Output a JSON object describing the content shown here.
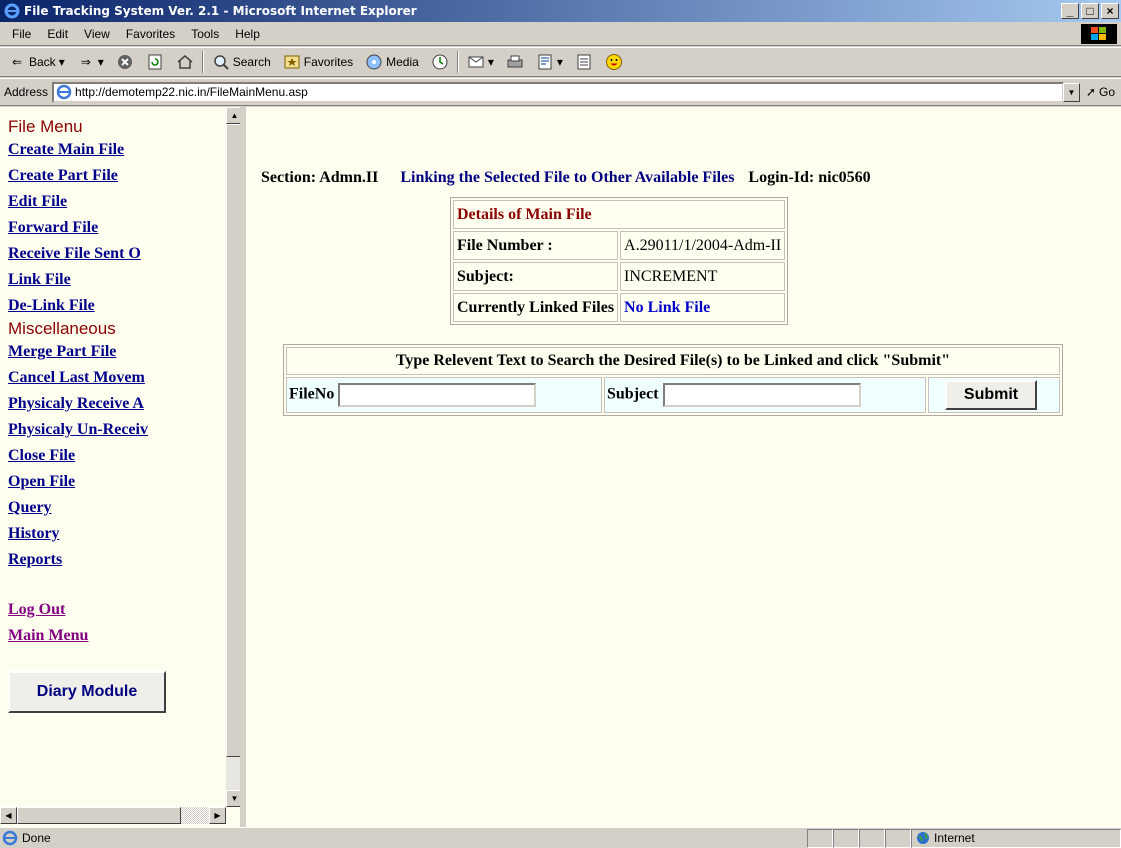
{
  "window": {
    "title": "File Tracking System Ver. 2.1 - Microsoft Internet Explorer",
    "minimize": "_",
    "maximize": "□",
    "close": "×"
  },
  "menubar": {
    "items": [
      "File",
      "Edit",
      "View",
      "Favorites",
      "Tools",
      "Help"
    ]
  },
  "toolbar": {
    "back": "Back",
    "search": "Search",
    "favorites": "Favorites",
    "media": "Media"
  },
  "address": {
    "label": "Address",
    "url": "http://demotemp22.nic.in/FileMainMenu.asp",
    "go": "Go"
  },
  "sidebar": {
    "file_menu_heading": "File Menu",
    "file_menu_items": [
      "Create Main File",
      "Create Part File",
      "Edit File",
      "Forward File",
      "Receive File Sent O",
      "Link File",
      "De-Link File"
    ],
    "misc_heading": "Miscellaneous",
    "misc_items": [
      "Merge Part File",
      "Cancel Last Movem",
      "Physicaly Receive A",
      "Physicaly Un-Receiv",
      "Close File",
      "Open File",
      "Query",
      "History",
      "Reports"
    ],
    "logout": "Log Out",
    "main_menu": "Main Menu",
    "diary_button": "Diary Module"
  },
  "main": {
    "section": "Section: Admn.II",
    "page_title": "Linking the Selected File to Other Available Files",
    "login": "Login-Id: nic0560",
    "details": {
      "heading": "Details of Main File",
      "file_number_label": "File Number :",
      "file_number_value": "A.29011/1/2004-Adm-II",
      "subject_label": "Subject:",
      "subject_value": "INCREMENT",
      "linked_label": "Currently Linked Files",
      "linked_value": "No Link File"
    },
    "search": {
      "instruction": "Type Relevent Text to Search the Desired File(s) to be Linked and click \"Submit\"",
      "fileno_label": "FileNo",
      "fileno_value": "",
      "subject_label": "Subject",
      "subject_value": "",
      "submit_label": "Submit"
    }
  },
  "status": {
    "text": "Done",
    "zone": "Internet"
  }
}
